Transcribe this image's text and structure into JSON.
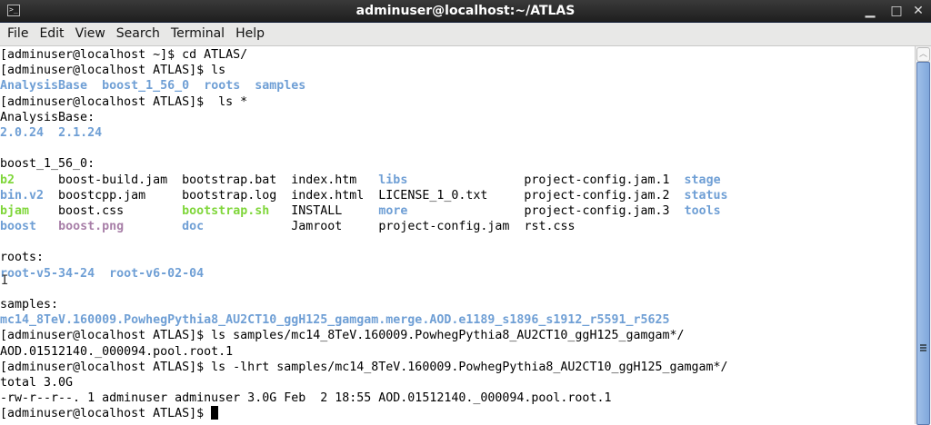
{
  "window": {
    "title": "adminuser@localhost:~/ATLAS",
    "minimize": "▁",
    "maximize": "□",
    "close": "✕",
    "icon": "terminal-icon"
  },
  "menu": [
    "File",
    "Edit",
    "View",
    "Search",
    "Terminal",
    "Help"
  ],
  "colors": {
    "directory": "#6f9fd5",
    "executable": "#7fd63a",
    "image": "#a87fa8"
  },
  "lines": [
    [
      {
        "t": "[adminuser@localhost ~]$ cd ATLAS/",
        "c": "n"
      }
    ],
    [
      {
        "t": "[adminuser@localhost ATLAS]$ ls",
        "c": "n"
      }
    ],
    [
      {
        "t": "AnalysisBase",
        "c": "d"
      },
      {
        "t": "  ",
        "c": "n"
      },
      {
        "t": "boost_1_56_0",
        "c": "d"
      },
      {
        "t": "  ",
        "c": "n"
      },
      {
        "t": "roots",
        "c": "d"
      },
      {
        "t": "  ",
        "c": "n"
      },
      {
        "t": "samples",
        "c": "d"
      }
    ],
    [
      {
        "t": "[adminuser@localhost ATLAS]$  ls *",
        "c": "n"
      }
    ],
    [
      {
        "t": "AnalysisBase:",
        "c": "n"
      }
    ],
    [
      {
        "t": "2.0.24",
        "c": "d"
      },
      {
        "t": "  ",
        "c": "n"
      },
      {
        "t": "2.1.24",
        "c": "d"
      }
    ],
    [],
    [
      {
        "t": "boost_1_56_0:",
        "c": "n"
      }
    ],
    [
      {
        "t": "b2",
        "c": "x"
      },
      {
        "t": "      boost-build.jam  bootstrap.bat  index.htm   ",
        "c": "n"
      },
      {
        "t": "libs",
        "c": "d"
      },
      {
        "t": "                project-config.jam.1  ",
        "c": "n"
      },
      {
        "t": "stage",
        "c": "d"
      }
    ],
    [
      {
        "t": "bin.v2",
        "c": "d"
      },
      {
        "t": "  boostcpp.jam     bootstrap.log  index.html  LICENSE_1_0.txt     project-config.jam.2  ",
        "c": "n"
      },
      {
        "t": "status",
        "c": "d"
      }
    ],
    [
      {
        "t": "bjam",
        "c": "x"
      },
      {
        "t": "    boost.css        ",
        "c": "n"
      },
      {
        "t": "bootstrap.sh",
        "c": "x"
      },
      {
        "t": "   INSTALL     ",
        "c": "n"
      },
      {
        "t": "more",
        "c": "d"
      },
      {
        "t": "                project-config.jam.3  ",
        "c": "n"
      },
      {
        "t": "tools",
        "c": "d"
      }
    ],
    [
      {
        "t": "boost",
        "c": "d"
      },
      {
        "t": "   ",
        "c": "n"
      },
      {
        "t": "boost.png",
        "c": "i"
      },
      {
        "t": "        ",
        "c": "n"
      },
      {
        "t": "doc",
        "c": "d"
      },
      {
        "t": "            Jamroot     project-config.jam  rst.css",
        "c": "n"
      }
    ],
    [],
    [
      {
        "t": "roots:",
        "c": "n"
      }
    ],
    [
      {
        "t": "root-v5-34-24",
        "c": "d"
      },
      {
        "t": "  ",
        "c": "n"
      },
      {
        "t": "root-v6-02-04",
        "c": "d"
      }
    ],
    [],
    [
      {
        "t": "samples:",
        "c": "n"
      }
    ],
    [
      {
        "t": "mc14_8TeV.160009.PowhegPythia8_AU2CT10_ggH125_gamgam.merge.AOD.e1189_s1896_s1912_r5591_r5625",
        "c": "d"
      }
    ],
    [
      {
        "t": "[adminuser@localhost ATLAS]$ ls samples/mc14_8TeV.160009.PowhegPythia8_AU2CT10_ggH125_gamgam*/",
        "c": "n"
      }
    ],
    [
      {
        "t": "AOD.01512140._000094.pool.root.1",
        "c": "n"
      }
    ],
    [
      {
        "t": "[adminuser@localhost ATLAS]$ ls -lhrt samples/mc14_8TeV.160009.PowhegPythia8_AU2CT10_ggH125_gamgam*/",
        "c": "n"
      }
    ],
    [
      {
        "t": "total 3.0G",
        "c": "n"
      }
    ],
    [
      {
        "t": "-rw-r--r--. 1 adminuser adminuser 3.0G Feb  2 18:55 AOD.01512140._000094.pool.root.1",
        "c": "n"
      }
    ],
    [
      {
        "t": "[adminuser@localhost ATLAS]$ ",
        "c": "n"
      }
    ]
  ]
}
